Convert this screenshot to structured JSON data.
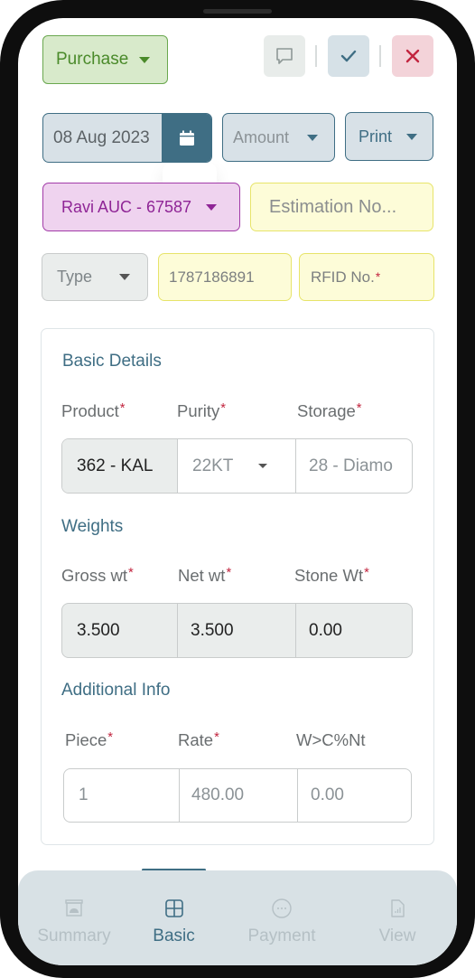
{
  "header": {
    "transaction_type": "Purchase",
    "actions": {
      "comment_icon": "speech-bubble-icon",
      "confirm_icon": "check-icon",
      "close_icon": "close-icon"
    }
  },
  "filters": {
    "date": "08 Aug 2023",
    "date_icon": "calendar-icon",
    "amount_select": "Amount",
    "print_select": "Print"
  },
  "customer": {
    "selected": "Ravi AUC - 67587",
    "estimation_placeholder": "Estimation No..."
  },
  "tag_row": {
    "type_select": "Type",
    "tag_number": "1787186891",
    "rfid_placeholder": "RFID No.",
    "required_mark": "*"
  },
  "card": {
    "basic_details": {
      "title": "Basic Details",
      "labels": [
        "Product",
        "Purity",
        "Storage"
      ],
      "values": {
        "product": "362 - KAL",
        "purity": "22KT",
        "storage": "28 - Diamo"
      }
    },
    "weights": {
      "title": "Weights",
      "labels": [
        "Gross wt",
        "Net wt",
        "Stone Wt"
      ],
      "values": {
        "gross": "3.500",
        "net": "3.500",
        "stone": "0.00"
      }
    },
    "additional_info": {
      "title": "Additional Info",
      "labels": [
        "Piece",
        "Rate",
        "W>C%Nt"
      ],
      "values": {
        "piece": "1",
        "rate": "480.00",
        "wc_percent": "0.00"
      }
    }
  },
  "bottom_nav": {
    "active": "Basic",
    "items": [
      {
        "label": "Summary",
        "icon": "archive-icon"
      },
      {
        "label": "Basic",
        "icon": "grid-icon"
      },
      {
        "label": "Payment",
        "icon": "more-circle-icon"
      },
      {
        "label": "View",
        "icon": "document-chart-icon"
      }
    ]
  },
  "colors": {
    "accent": "#3f6e84",
    "purchase_green": "#4a8a2a",
    "customer_purple": "#8f2596",
    "required_red": "#c2253f",
    "close_red": "#c2253f"
  }
}
